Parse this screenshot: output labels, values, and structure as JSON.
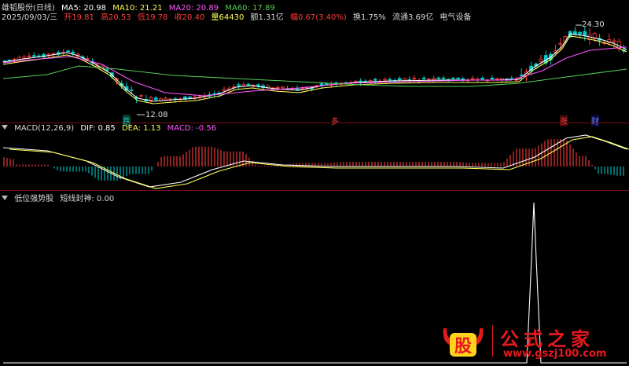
{
  "header": {
    "stock_name": "雄韬股份(日线)",
    "ma5": "MA5: 20.98",
    "ma10": "MA10: 21.21",
    "ma20": "MA20: 20.89",
    "ma60": "MA60: 17.89",
    "date": "2025/09/03/三",
    "open": "开19.81",
    "high": "高20.53",
    "low": "低19.78",
    "close": "收20.40",
    "volume": "量64430",
    "amount": "额1.31亿",
    "change": "幅0.67(3.40%)",
    "turnover": "换1.75%",
    "float_cap": "流通3.69亿",
    "sector": "电气设备"
  },
  "price_chart": {
    "high_label": "24.30",
    "low_label": "12.08",
    "tags": {
      "die": "跌",
      "duo": "多",
      "zhang": "涨",
      "cai": "财"
    }
  },
  "macd": {
    "title": "MACD(12,26,9)",
    "dif": "DIF: 0.85",
    "dea": "DEA: 1.13",
    "macd": "MACD: -0.56"
  },
  "indicator": {
    "title": "低位强势股",
    "line_name": "短线封神: 0.00"
  },
  "watermark": {
    "logo_char": "股",
    "text": "公式之家",
    "url": "www.gszj100.com"
  },
  "colors": {
    "background": "#000000",
    "up": "#ff3c3c",
    "down": "#00c8c8",
    "ma5": "#ffffff",
    "ma10": "#ffff55",
    "ma20": "#ff55ff",
    "ma60": "#55cc55",
    "separator": "#7a0f12",
    "watermark": "#e8191c"
  }
}
